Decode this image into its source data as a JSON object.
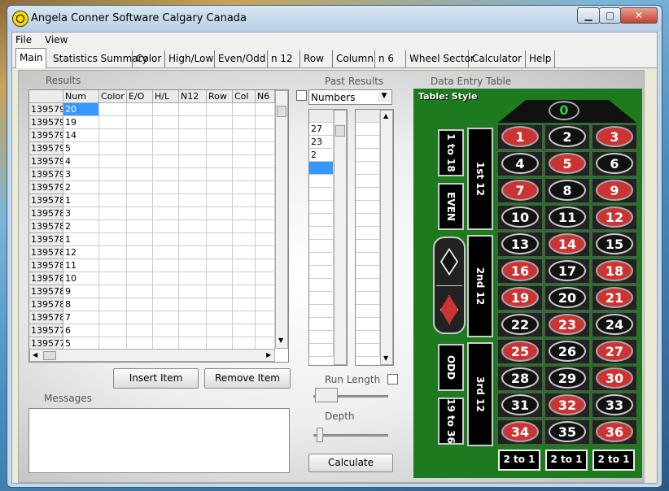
{
  "window": {
    "title": "Angela Conner Software  Calgary Canada",
    "min": "▁",
    "max": "▢",
    "close": "✕"
  },
  "menu": [
    "File",
    "View"
  ],
  "tabs": [
    "Main",
    "Statistics Summary",
    "Color",
    "High/Low",
    "Even/Odd",
    "n 12",
    "Row",
    "Column",
    "n 6",
    "Wheel Sector",
    "Calculator",
    "Help"
  ],
  "results": {
    "label": "Results",
    "columns": [
      "",
      "Num",
      "Color",
      "E/O",
      "H/L",
      "N12",
      "Row",
      "Col",
      "N6"
    ],
    "rows": [
      [
        "139579",
        "20"
      ],
      [
        "139579",
        "19"
      ],
      [
        "139579",
        "14"
      ],
      [
        "139579",
        "5"
      ],
      [
        "139579",
        "4"
      ],
      [
        "139579",
        "3"
      ],
      [
        "139579",
        "2"
      ],
      [
        "139578",
        "1"
      ],
      [
        "139578",
        "3"
      ],
      [
        "139578",
        "2"
      ],
      [
        "139578",
        "1"
      ],
      [
        "139578",
        "12"
      ],
      [
        "139578",
        "11"
      ],
      [
        "139578",
        "10"
      ],
      [
        "139578",
        "9"
      ],
      [
        "139578",
        "8"
      ],
      [
        "139578",
        "7"
      ],
      [
        "139577",
        "6"
      ],
      [
        "139577",
        "5"
      ]
    ]
  },
  "buttons": {
    "insert": "Insert Item",
    "remove": "Remove Item",
    "calculate": "Calculate"
  },
  "messages": {
    "label": "Messages"
  },
  "past": {
    "label": "Past Results",
    "dropdown": "Numbers",
    "values": [
      "27",
      "23",
      "2"
    ]
  },
  "runlength": {
    "label": "Run Length"
  },
  "depth": {
    "label": "Depth"
  },
  "table": {
    "label": "Data Entry Table",
    "style": "Table: Style",
    "zero": "0",
    "numbers": [
      [
        "1",
        "r"
      ],
      [
        "2",
        "b"
      ],
      [
        "3",
        "r"
      ],
      [
        "4",
        "b"
      ],
      [
        "5",
        "r"
      ],
      [
        "6",
        "b"
      ],
      [
        "7",
        "r"
      ],
      [
        "8",
        "b"
      ],
      [
        "9",
        "r"
      ],
      [
        "10",
        "b"
      ],
      [
        "11",
        "b"
      ],
      [
        "12",
        "r"
      ],
      [
        "13",
        "b"
      ],
      [
        "14",
        "r"
      ],
      [
        "15",
        "b"
      ],
      [
        "16",
        "r"
      ],
      [
        "17",
        "b"
      ],
      [
        "18",
        "r"
      ],
      [
        "19",
        "r"
      ],
      [
        "20",
        "b"
      ],
      [
        "21",
        "r"
      ],
      [
        "22",
        "b"
      ],
      [
        "23",
        "r"
      ],
      [
        "24",
        "b"
      ],
      [
        "25",
        "r"
      ],
      [
        "26",
        "b"
      ],
      [
        "27",
        "r"
      ],
      [
        "28",
        "b"
      ],
      [
        "29",
        "b"
      ],
      [
        "30",
        "r"
      ],
      [
        "31",
        "b"
      ],
      [
        "32",
        "r"
      ],
      [
        "33",
        "b"
      ],
      [
        "34",
        "r"
      ],
      [
        "35",
        "b"
      ],
      [
        "36",
        "r"
      ]
    ],
    "dozens": [
      "1st 12",
      "2nd 12",
      "3rd 12"
    ],
    "outside": [
      "1 to 18",
      "EVEN",
      "ODD",
      "19 to 36"
    ],
    "columns": [
      "2 to 1",
      "2 to 1",
      "2 to 1"
    ]
  },
  "colors": {
    "red": "#cc3333",
    "black": "#111111",
    "felt": "#1e7a1e"
  }
}
